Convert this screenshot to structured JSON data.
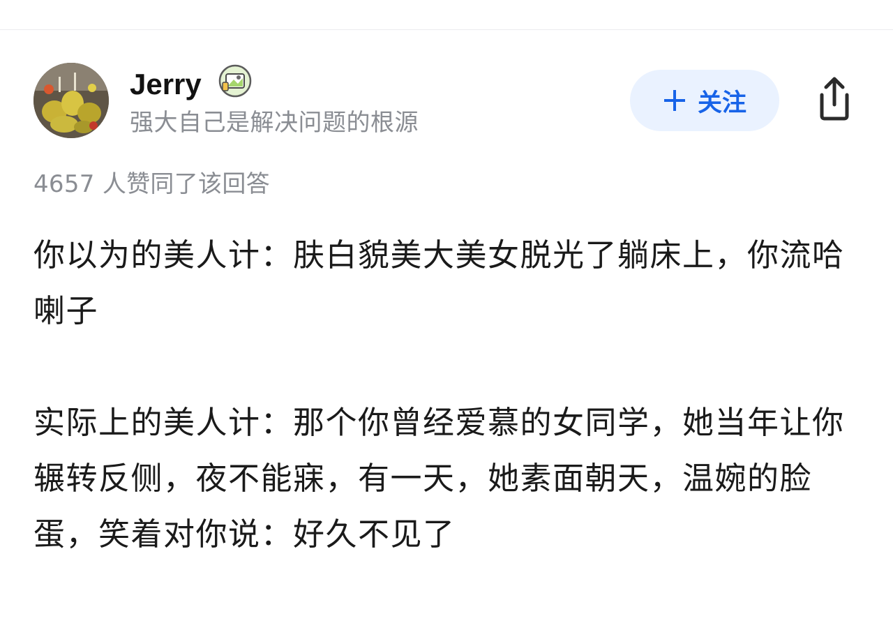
{
  "author": {
    "name": "Jerry",
    "bio": "强大自己是解决问题的根源",
    "avatar_icon": "avatar-photo",
    "badge_icon": "achievement-badge-icon"
  },
  "actions": {
    "follow_label": "关注",
    "follow_icon": "plus-icon",
    "share_icon": "share-icon",
    "accent_color": "#1763e8",
    "follow_bg": "#eaf2ff"
  },
  "vote_text": "4657 人赞同了该回答",
  "answer": {
    "paragraphs": [
      "你以为的美人计：肤白貌美大美女脱光了躺床上，你流哈喇子",
      "实际上的美人计：那个你曾经爱慕的女同学，她当年让你辗转反侧，夜不能寐，有一天，她素面朝天，温婉的脸蛋，笑着对你说：好久不见了"
    ]
  }
}
